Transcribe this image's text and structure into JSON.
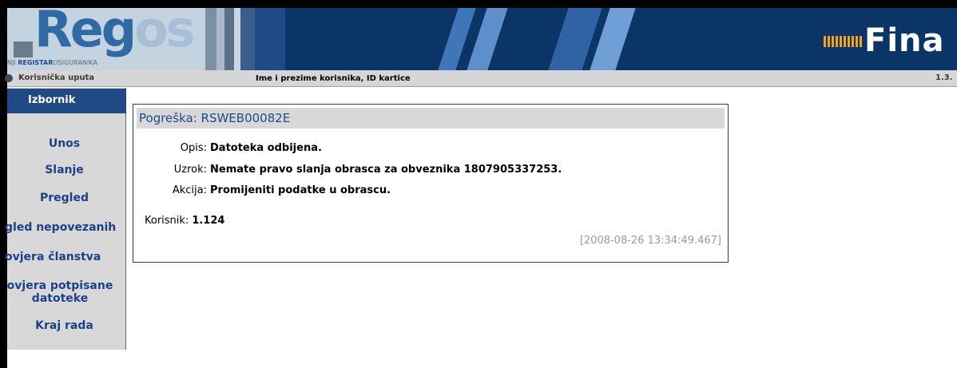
{
  "banner": {
    "logo_text_main": "Reg",
    "logo_text_os": "os",
    "logo_tagline_prefix": "NJI ",
    "logo_tagline_bold": "REGISTAR",
    "logo_tagline_suffix": "OSIGURANIKA",
    "brand_right": "Fina"
  },
  "strip": {
    "help_label": "Korisnička uputa",
    "user_label": "Ime i prezime korisnika, ID kartice",
    "version": "1.3."
  },
  "sidebar": {
    "header": "Izbornik",
    "items": [
      {
        "label": "Unos"
      },
      {
        "label": "Slanje"
      },
      {
        "label": "Pregled"
      },
      {
        "label": "gled nepovezanih"
      },
      {
        "label": "ovjera članstva"
      },
      {
        "label": "ovjera potpisane datoteke"
      },
      {
        "label": "Kraj rada"
      }
    ]
  },
  "error": {
    "title": "Pogreška: RSWEB00082E",
    "opis_label": "Opis:",
    "opis_value": "Datoteka odbijena.",
    "uzrok_label": "Uzrok:",
    "uzrok_value": "Nemate pravo slanja obrasca za obveznika 1807905337253.",
    "akcija_label": "Akcija:",
    "akcija_value": "Promijeniti podatke u obrascu.",
    "korisnik_label": "Korisnik:",
    "korisnik_value": "1.124",
    "timestamp": "[2008-08-26 13:34:49.467]"
  },
  "colors": {
    "banner_bg": "#0b3566",
    "nav_text": "#1e3f8a",
    "sidebar_header_bg": "#1f4a85",
    "fina_accent": "#f4a31a"
  }
}
